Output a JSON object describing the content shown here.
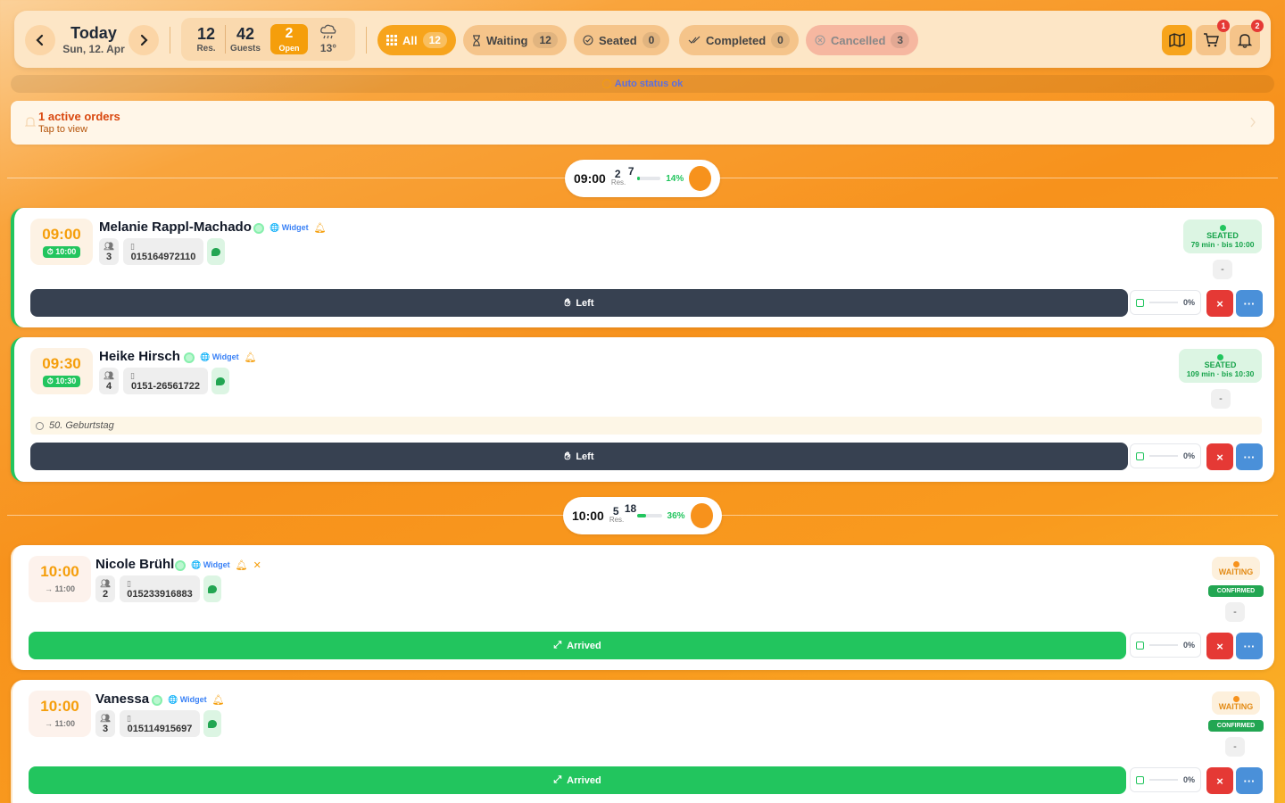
{
  "header": {
    "title": "Today",
    "date": "Sun, 12. Apr",
    "stats": {
      "res": "12",
      "res_label": "Res.",
      "guests": "42",
      "guests_label": "Guests",
      "open": "2",
      "open_label": "Open",
      "temp": "13°"
    },
    "filters": [
      {
        "label": "All",
        "count": "12"
      },
      {
        "label": "Waiting",
        "count": "12"
      },
      {
        "label": "Seated",
        "count": "0"
      },
      {
        "label": "Completed",
        "count": "0"
      },
      {
        "label": "Cancelled",
        "count": "3"
      }
    ],
    "cart_badge": "1",
    "notif_badge": "2"
  },
  "auto_status": "Auto status ok",
  "orders_banner": {
    "title": "1 active orders",
    "sub": "Tap to view"
  },
  "slots": [
    {
      "time": "09:00",
      "res": "2",
      "res_label": "Res.",
      "guests": "7",
      "pct": "14%",
      "fill": 0.14
    },
    {
      "time": "10:00",
      "res": "5",
      "res_label": "Res.",
      "guests": "18",
      "pct": "36%",
      "fill": 0.36
    }
  ],
  "reservations": [
    {
      "time": "09:00",
      "end": "10:00",
      "name": "Melanie Rappl-Machado",
      "source": "Widget",
      "guests": "3",
      "phone": "015164972110",
      "status": "SEATED",
      "status_detail": "79 min · bis 10:00",
      "action": "Left",
      "progress": "0%",
      "dash": "-"
    },
    {
      "time": "09:30",
      "end": "10:30",
      "name": "Heike Hirsch",
      "source": "Widget",
      "guests": "4",
      "phone": "0151-26561722",
      "note": "50. Geburtstag",
      "status": "SEATED",
      "status_detail": "109 min · bis 10:30",
      "action": "Left",
      "progress": "0%",
      "dash": "-"
    },
    {
      "time": "10:00",
      "end": "→ 11:00",
      "name": "Nicole Brühl",
      "source": "Widget",
      "guests": "2",
      "phone": "015233916883",
      "status": "WAITING",
      "confirm": "CONFIRMED",
      "action": "Arrived",
      "progress": "0%",
      "dash": "-"
    },
    {
      "time": "10:00",
      "end": "→ 11:00",
      "name": "Vanessa",
      "source": "Widget",
      "guests": "3",
      "phone": "015114915697",
      "status": "WAITING",
      "confirm": "CONFIRMED",
      "action": "Arrived",
      "progress": "0%",
      "dash": "-"
    }
  ],
  "colors": {
    "accent": "#f59e0b",
    "seated": "#22c55e",
    "dark": "#374151",
    "danger": "#e53935",
    "info": "#4a90d9"
  }
}
